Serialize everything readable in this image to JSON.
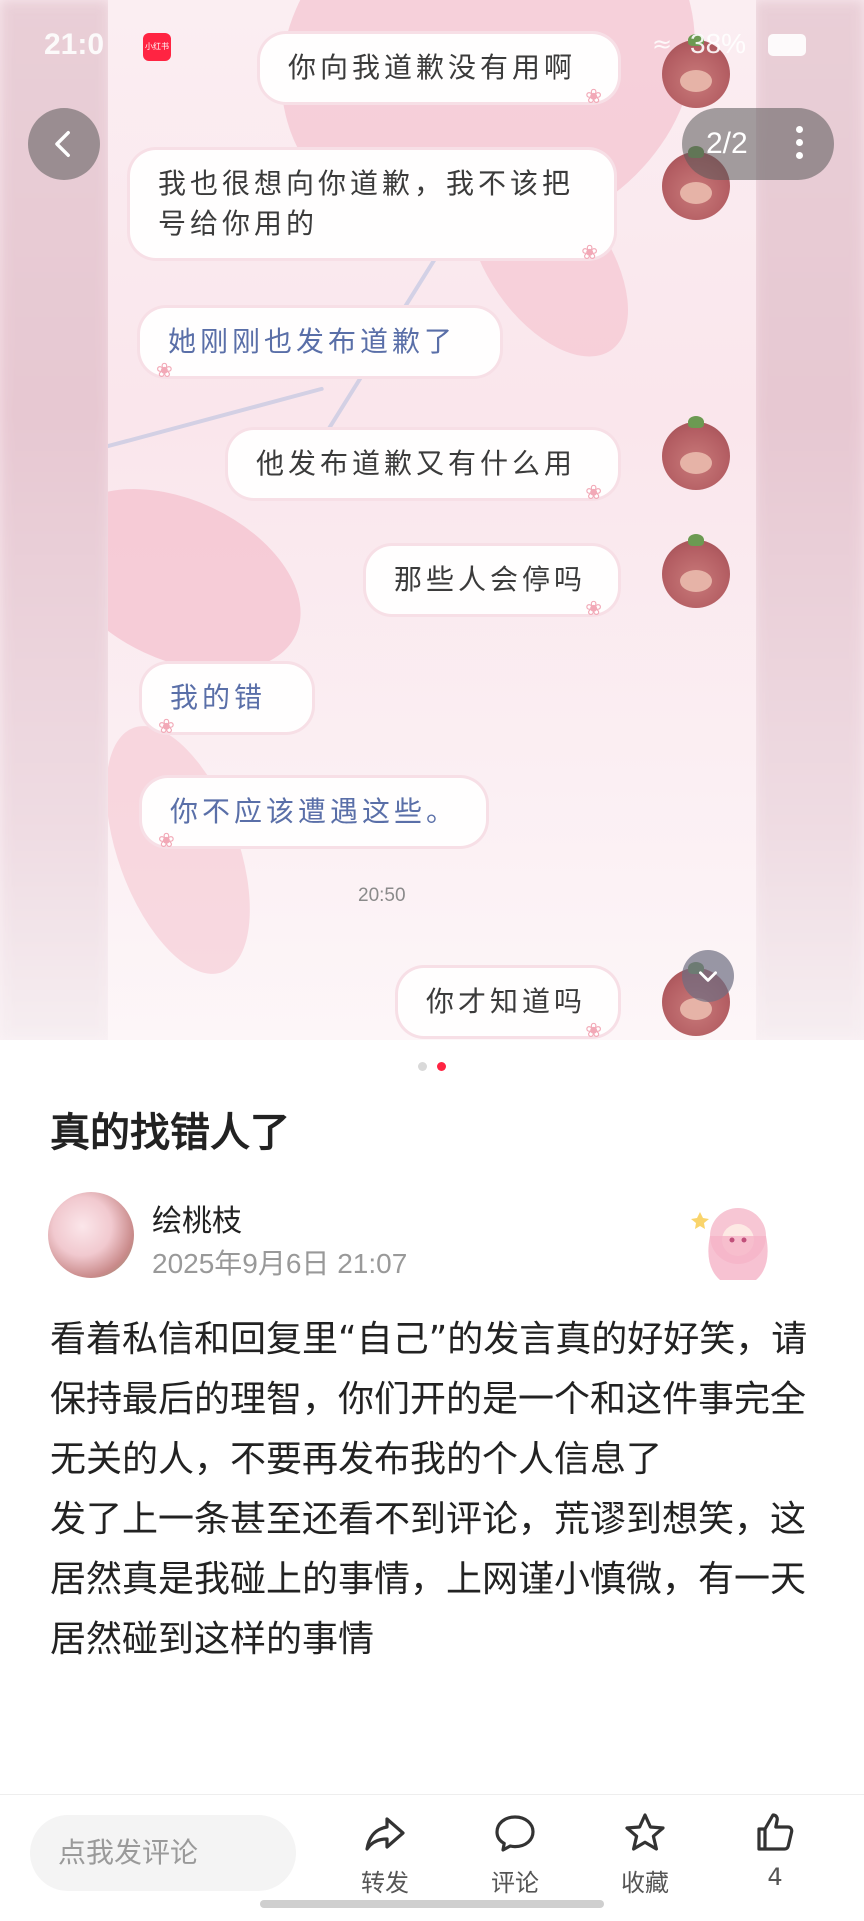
{
  "status_bar": {
    "time": "21:0",
    "app_badge": "小红书",
    "battery": "38%"
  },
  "carousel": {
    "counter": "2/2",
    "total_dots": 2,
    "active_dot": 2
  },
  "chat": {
    "messages": [
      {
        "side": "me",
        "text": "你向我道歉没有用啊"
      },
      {
        "side": "me",
        "text": "我也很想向你道歉，我不该把号给你用的"
      },
      {
        "side": "her",
        "text": "她刚刚也发布道歉了"
      },
      {
        "side": "me",
        "text": "他发布道歉又有什么用"
      },
      {
        "side": "me",
        "text": "那些人会停吗"
      },
      {
        "side": "her",
        "text": "我的错"
      },
      {
        "side": "her",
        "text": "你不应该遭遇这些。"
      },
      {
        "side": "me",
        "text": "你才知道吗"
      }
    ],
    "timestamp": "20:50"
  },
  "post": {
    "title": "真的找错人了",
    "author": "绘桃枝",
    "date": "2025年9月6日 21:07",
    "paragraphs": [
      "看着私信和回复里“自己”的发言真的好好笑，请保持最后的理智，你们开的是一个和这件事完全无关的人，不要再发布我的个人信息了",
      "发了上一条甚至还看不到评论，荒谬到想笑，这居然真是我碰上的事情，上网谨小慎微，有一天居然碰到这样的事情"
    ]
  },
  "bottom_bar": {
    "comment_placeholder": "点我发评论",
    "share_label": "转发",
    "comment_label": "评论",
    "collect_label": "收藏",
    "like_count": "4"
  },
  "colors": {
    "brand": "#ff2442",
    "bubble_her_text": "#5a6fa8",
    "background_pink": "#f9e9ee"
  }
}
